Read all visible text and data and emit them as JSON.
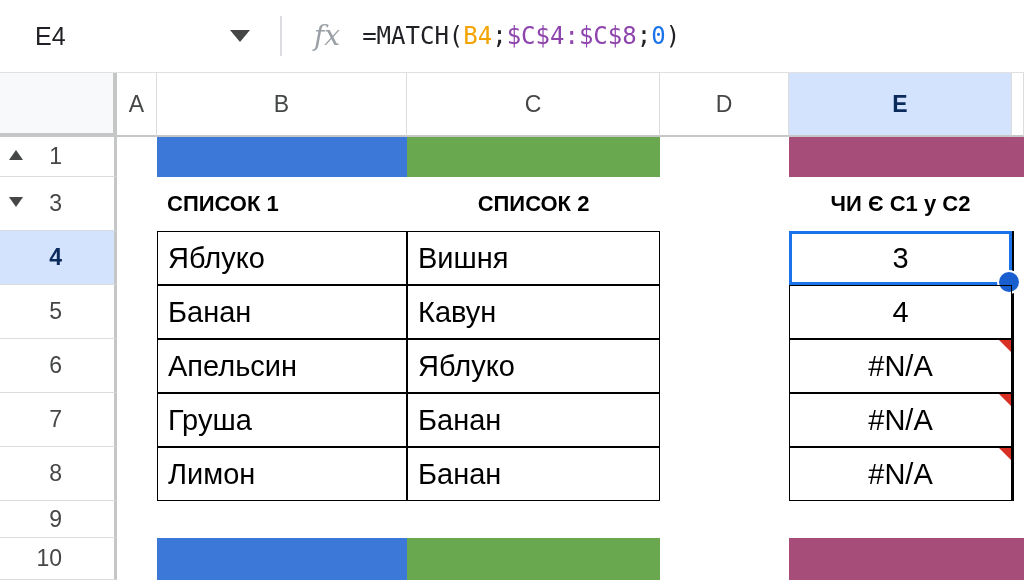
{
  "formula_bar": {
    "cell_ref": "E4",
    "function_label": "fx",
    "formula": [
      {
        "text": "=MATCH(",
        "color": "#202124"
      },
      {
        "text": "B4",
        "color": "#f4a300"
      },
      {
        "text": ";",
        "color": "#202124"
      },
      {
        "text": "$C$4:$C$8",
        "color": "#8e44ad"
      },
      {
        "text": ";",
        "color": "#202124"
      },
      {
        "text": "0",
        "color": "#1a73e8"
      },
      {
        "text": ")",
        "color": "#202124"
      }
    ]
  },
  "columns": [
    {
      "label": "A",
      "selected": false
    },
    {
      "label": "B",
      "selected": false
    },
    {
      "label": "C",
      "selected": false
    },
    {
      "label": "D",
      "selected": false
    },
    {
      "label": "E",
      "selected": true
    }
  ],
  "rows": [
    {
      "label": "1",
      "selected": false,
      "toggle": {
        "expanded": true
      },
      "kind": "band",
      "b": {
        "color": "#3c78d8"
      },
      "c": {
        "color": "#6aa84f"
      },
      "e": {
        "color": "#a64d79"
      }
    },
    {
      "label": "3",
      "selected": false,
      "toggle": {
        "expanded": false
      },
      "kind": "header",
      "b": {
        "text": "СПИСОК 1"
      },
      "c": {
        "text": "СПИСОК 2"
      },
      "e": {
        "text": "ЧИ Є С1 у С2"
      }
    },
    {
      "label": "4",
      "selected": true,
      "kind": "data",
      "b": "Яблуко",
      "c": "Вишня",
      "e": {
        "text": "3",
        "selected": true,
        "error": false
      }
    },
    {
      "label": "5",
      "selected": false,
      "kind": "data",
      "b": "Банан",
      "c": "Кавун",
      "e": {
        "text": "4",
        "selected": false,
        "error": false
      }
    },
    {
      "label": "6",
      "selected": false,
      "kind": "data",
      "b": "Апельсин",
      "c": "Яблуко",
      "e": {
        "text": "#N/A",
        "selected": false,
        "error": true
      }
    },
    {
      "label": "7",
      "selected": false,
      "kind": "data",
      "b": "Груша",
      "c": "Банан",
      "e": {
        "text": "#N/A",
        "selected": false,
        "error": true
      }
    },
    {
      "label": "8",
      "selected": false,
      "kind": "data",
      "b": "Лимон",
      "c": "Банан",
      "e": {
        "text": "#N/A",
        "selected": false,
        "error": true
      }
    },
    {
      "label": "9",
      "selected": false,
      "kind": "empty"
    },
    {
      "label": "10",
      "selected": false,
      "kind": "band",
      "b": {
        "color": "#3c78d8"
      },
      "c": {
        "color": "#6aa84f"
      },
      "e": {
        "color": "#a64d79"
      }
    }
  ]
}
